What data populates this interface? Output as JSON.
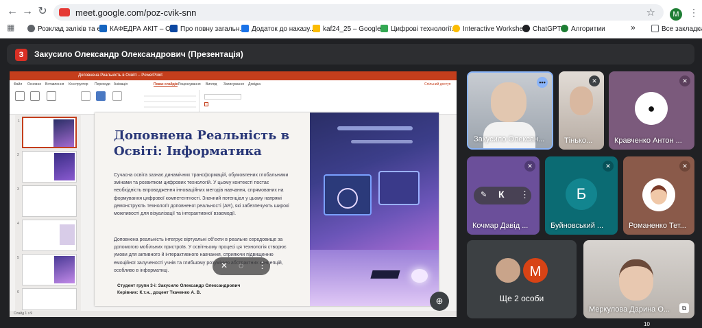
{
  "browser": {
    "url": "meet.google.com/poz-cvik-snn",
    "profile_initial": "M",
    "bookmarks": [
      {
        "label": "Розклад заліків та е...",
        "color": "#5f6368"
      },
      {
        "label": "КАФЕДРА АКІТ – О...",
        "color": "#1565c0"
      },
      {
        "label": "Про повну загальн...",
        "color": "#0d47a1"
      },
      {
        "label": "Додаток до наказу...",
        "color": "#1a73e8"
      },
      {
        "label": "kaf24_25 – Google...",
        "color": "#fbbc04"
      },
      {
        "label": "Цифрові технології...",
        "color": "#34a853"
      },
      {
        "label": "Interactive Workshe...",
        "color": "#fbbc04"
      },
      {
        "label": "ChatGPT",
        "color": "#202124"
      },
      {
        "label": "Алгоритми",
        "color": "#1e7e34"
      }
    ],
    "bookmarks_overflow": "»",
    "all_bookmarks": "Все закладки"
  },
  "meet": {
    "presenter_initial": "З",
    "presentation_title": "Закусило Олександр Олександрович (Презентація)",
    "participants": [
      {
        "name": "Закусило Олексан...",
        "muted": false
      },
      {
        "name": "Тінько...",
        "muted": true
      },
      {
        "name": "Кравченко Антон ...",
        "muted": true
      },
      {
        "name": "Кочмар Давід ...",
        "muted": true,
        "initial": "К"
      },
      {
        "name": "Буйновський ...",
        "muted": true,
        "initial": "Б"
      },
      {
        "name": "Романенко Тет...",
        "muted": true
      },
      {
        "name": "Меркулова Дарина О...",
        "muted": false
      }
    ],
    "others_label": "Ще 2 особи",
    "others_initial": "М",
    "participant_count": "10"
  },
  "powerpoint": {
    "window_title": "Доповнена Реальність в Освіті – PowerPoint",
    "tabs": [
      "Файл",
      "Основне",
      "Вставлення",
      "Конструктор",
      "Переходи",
      "Анімація",
      "Показ слайдів",
      "Рецензування",
      "Вигляд",
      "Записування",
      "Довідка"
    ],
    "active_tab": "Показ слайдів",
    "share_label": "Спільний доступ",
    "status_text": "Слайд 1 з 9",
    "slide": {
      "title": "Доповнена Реальність в Освіті: Інформатика",
      "paragraph1": "Сучасна освіта зазнає динамічних трансформацій, обумовлених глобальними змінами та розвитком цифрових технологій. У цьому контексті постає необхідність впровадження інноваційних методів навчання, спрямованих на формування цифрової компетентності. Значний потенціал у цьому напрямі демонструють технології доповненої реальності (AR), які забезпечують широкі можливості для візуалізації та інтерактивної взаємодії.",
      "paragraph2": "Доповнена реальність інтегрує віртуальні об'єкти в реальне середовище за допомогою мобільних пристроїв. У освітньому процесі ця технологія створює умови для активного й інтерактивного навчання, сприяючи підвищенню емоційної залученості учнів та глибшому розумінню абстрактних концепцій, особливо в інформатиці.",
      "author": "Студент групи 3-і: Закусило Олександр Олександрович",
      "supervisor": "Керівник: К.т.н., доцент Ткаченко А. В."
    },
    "thumbnails": [
      "1",
      "2",
      "3",
      "4",
      "5",
      "6"
    ]
  }
}
